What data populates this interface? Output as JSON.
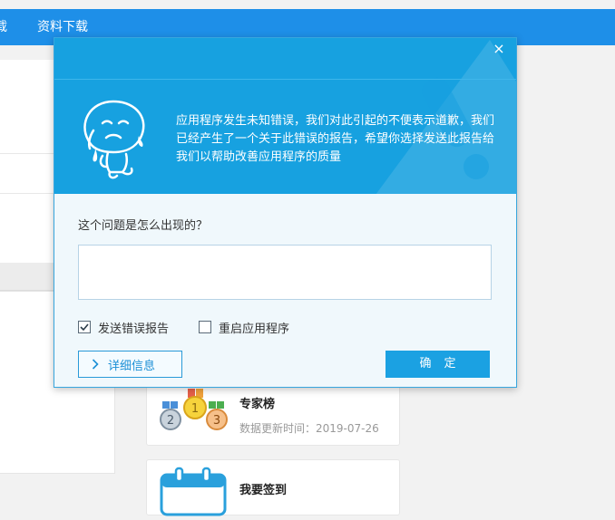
{
  "nav": {
    "item_cut": "载",
    "item_download": "资料下载"
  },
  "cards": {
    "experts": {
      "title": "专家榜",
      "updated": "数据更新时间：2019-07-26"
    },
    "checkin": {
      "title": "我要签到"
    }
  },
  "medals": [
    "2",
    "1",
    "3"
  ],
  "dialog": {
    "close_label": "×",
    "message": "应用程序发生未知错误，我们对此引起的不便表示道歉，我们已经产生了一个关于此错误的报告，希望你选择发送此报告给我们以帮助改善应用程序的质量",
    "question": "这个问题是怎么出现的？",
    "input_value": "",
    "send_report": {
      "label": "发送错误报告",
      "checked": true
    },
    "restart_app": {
      "label": "重启应用程序",
      "checked": false
    },
    "details_label": "详细信息",
    "ok_label": "确定"
  },
  "colors": {
    "nav_blue": "#1e8fe8",
    "header_blue": "#17a1e0",
    "button_blue": "#1ba1e2",
    "border_blue": "#2a9ad8"
  }
}
